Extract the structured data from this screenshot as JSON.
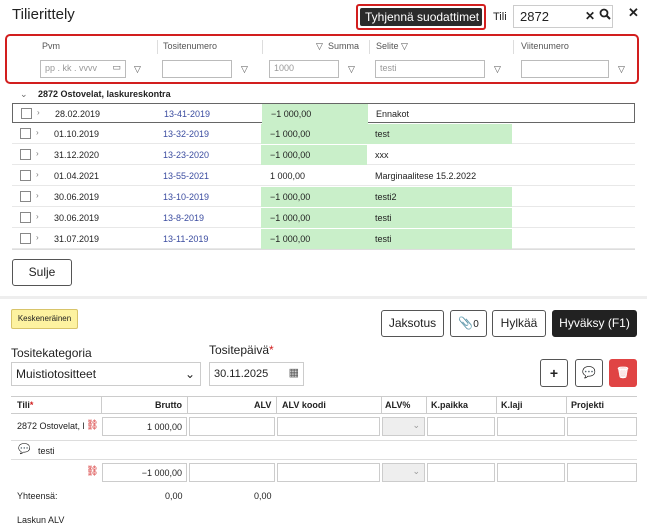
{
  "title": "Tilierittely",
  "clear_filters": "Tyhjennä suodattimet",
  "tili_label": "Tili",
  "tili_value": "2872",
  "filters": {
    "headers": {
      "pvm": "Pvm",
      "tositenumero": "Tositenumero",
      "summa": "Summa",
      "selite": "Selite",
      "viitenumero": "Viitenumero"
    },
    "date_placeholder": "pp . kk . vvvv",
    "summa_value": "1000",
    "selite_value": "testi"
  },
  "group_label": "2872 Ostovelat, laskureskontra",
  "rows": [
    {
      "date": "28.02.2019",
      "number": "13-41-2019",
      "amount": "−1 000,00",
      "desc": "Ennakot",
      "amt_green": true,
      "desc_green": false
    },
    {
      "date": "01.10.2019",
      "number": "13-32-2019",
      "amount": "−1 000,00",
      "desc": "test",
      "amt_green": true,
      "desc_green": true
    },
    {
      "date": "31.12.2020",
      "number": "13-23-2020",
      "amount": "−1 000,00",
      "desc": "xxx",
      "amt_green": true,
      "desc_green": false
    },
    {
      "date": "01.04.2021",
      "number": "13-55-2021",
      "amount": "1 000,00",
      "desc": "Marginaalitese 15.2.2022",
      "amt_green": false,
      "desc_green": false
    },
    {
      "date": "30.06.2019",
      "number": "13-10-2019",
      "amount": "−1 000,00",
      "desc": "testi2",
      "amt_green": true,
      "desc_green": true
    },
    {
      "date": "30.06.2019",
      "number": "13-8-2019",
      "amount": "−1 000,00",
      "desc": "testi",
      "amt_green": true,
      "desc_green": true
    },
    {
      "date": "31.07.2019",
      "number": "13-11-2019",
      "amount": "−1 000,00",
      "desc": "testi",
      "amt_green": true,
      "desc_green": true
    }
  ],
  "sulje": "Sulje",
  "status_badge": "Keskeneräinen",
  "buttons": {
    "jaksotus": "Jaksotus",
    "attachments": "0",
    "hylkaa": "Hylkää",
    "hyvaksy": "Hyväksy (F1)"
  },
  "tositekategoria_label": "Tositekategoria",
  "tositekategoria_value": "Muistiotositteet",
  "tositepaiva_label": "Tositepäivä",
  "tositepaiva_value": "30.11.2025",
  "entry_table": {
    "headers": {
      "tili": "Tili",
      "brutto": "Brutto",
      "alv": "ALV",
      "alv_koodi": "ALV koodi",
      "alv_pct": "ALV%",
      "kpaikka": "K.paikka",
      "klaji": "K.laji",
      "projekti": "Projekti"
    },
    "row1_account": "2872 Ostovelat, l",
    "row1_brutto": "1 000,00",
    "comment": "testi",
    "row2_brutto": "−1 000,00"
  },
  "yhteensa_label": "Yhteensä:",
  "yhteensa_brutto": "0,00",
  "yhteensa_alv": "0,00",
  "laskun_alv": "Laskun ALV",
  "colors": {
    "highlight_green": "#c9efc9",
    "red_border": "#d21e1e",
    "link": "#3b4ca0",
    "badge": "#fdf2a0"
  }
}
